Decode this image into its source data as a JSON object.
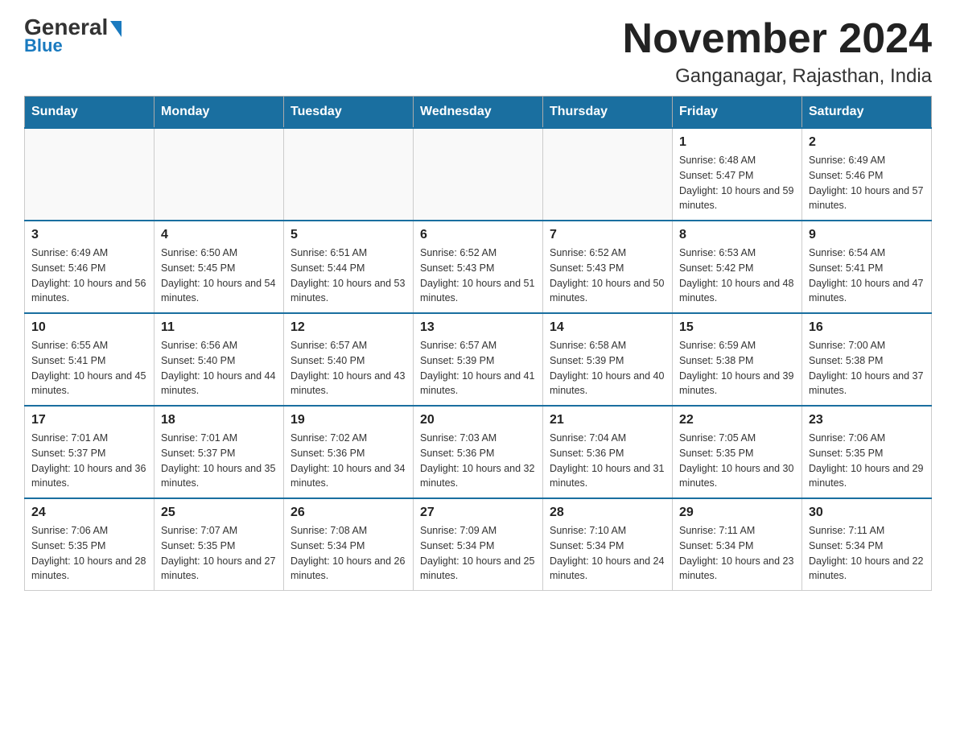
{
  "header": {
    "logo_general": "General",
    "logo_blue": "Blue",
    "title": "November 2024",
    "subtitle": "Ganganagar, Rajasthan, India"
  },
  "days_of_week": [
    "Sunday",
    "Monday",
    "Tuesday",
    "Wednesday",
    "Thursday",
    "Friday",
    "Saturday"
  ],
  "weeks": [
    {
      "days": [
        {
          "number": "",
          "info": ""
        },
        {
          "number": "",
          "info": ""
        },
        {
          "number": "",
          "info": ""
        },
        {
          "number": "",
          "info": ""
        },
        {
          "number": "",
          "info": ""
        },
        {
          "number": "1",
          "info": "Sunrise: 6:48 AM\nSunset: 5:47 PM\nDaylight: 10 hours and 59 minutes."
        },
        {
          "number": "2",
          "info": "Sunrise: 6:49 AM\nSunset: 5:46 PM\nDaylight: 10 hours and 57 minutes."
        }
      ]
    },
    {
      "days": [
        {
          "number": "3",
          "info": "Sunrise: 6:49 AM\nSunset: 5:46 PM\nDaylight: 10 hours and 56 minutes."
        },
        {
          "number": "4",
          "info": "Sunrise: 6:50 AM\nSunset: 5:45 PM\nDaylight: 10 hours and 54 minutes."
        },
        {
          "number": "5",
          "info": "Sunrise: 6:51 AM\nSunset: 5:44 PM\nDaylight: 10 hours and 53 minutes."
        },
        {
          "number": "6",
          "info": "Sunrise: 6:52 AM\nSunset: 5:43 PM\nDaylight: 10 hours and 51 minutes."
        },
        {
          "number": "7",
          "info": "Sunrise: 6:52 AM\nSunset: 5:43 PM\nDaylight: 10 hours and 50 minutes."
        },
        {
          "number": "8",
          "info": "Sunrise: 6:53 AM\nSunset: 5:42 PM\nDaylight: 10 hours and 48 minutes."
        },
        {
          "number": "9",
          "info": "Sunrise: 6:54 AM\nSunset: 5:41 PM\nDaylight: 10 hours and 47 minutes."
        }
      ]
    },
    {
      "days": [
        {
          "number": "10",
          "info": "Sunrise: 6:55 AM\nSunset: 5:41 PM\nDaylight: 10 hours and 45 minutes."
        },
        {
          "number": "11",
          "info": "Sunrise: 6:56 AM\nSunset: 5:40 PM\nDaylight: 10 hours and 44 minutes."
        },
        {
          "number": "12",
          "info": "Sunrise: 6:57 AM\nSunset: 5:40 PM\nDaylight: 10 hours and 43 minutes."
        },
        {
          "number": "13",
          "info": "Sunrise: 6:57 AM\nSunset: 5:39 PM\nDaylight: 10 hours and 41 minutes."
        },
        {
          "number": "14",
          "info": "Sunrise: 6:58 AM\nSunset: 5:39 PM\nDaylight: 10 hours and 40 minutes."
        },
        {
          "number": "15",
          "info": "Sunrise: 6:59 AM\nSunset: 5:38 PM\nDaylight: 10 hours and 39 minutes."
        },
        {
          "number": "16",
          "info": "Sunrise: 7:00 AM\nSunset: 5:38 PM\nDaylight: 10 hours and 37 minutes."
        }
      ]
    },
    {
      "days": [
        {
          "number": "17",
          "info": "Sunrise: 7:01 AM\nSunset: 5:37 PM\nDaylight: 10 hours and 36 minutes."
        },
        {
          "number": "18",
          "info": "Sunrise: 7:01 AM\nSunset: 5:37 PM\nDaylight: 10 hours and 35 minutes."
        },
        {
          "number": "19",
          "info": "Sunrise: 7:02 AM\nSunset: 5:36 PM\nDaylight: 10 hours and 34 minutes."
        },
        {
          "number": "20",
          "info": "Sunrise: 7:03 AM\nSunset: 5:36 PM\nDaylight: 10 hours and 32 minutes."
        },
        {
          "number": "21",
          "info": "Sunrise: 7:04 AM\nSunset: 5:36 PM\nDaylight: 10 hours and 31 minutes."
        },
        {
          "number": "22",
          "info": "Sunrise: 7:05 AM\nSunset: 5:35 PM\nDaylight: 10 hours and 30 minutes."
        },
        {
          "number": "23",
          "info": "Sunrise: 7:06 AM\nSunset: 5:35 PM\nDaylight: 10 hours and 29 minutes."
        }
      ]
    },
    {
      "days": [
        {
          "number": "24",
          "info": "Sunrise: 7:06 AM\nSunset: 5:35 PM\nDaylight: 10 hours and 28 minutes."
        },
        {
          "number": "25",
          "info": "Sunrise: 7:07 AM\nSunset: 5:35 PM\nDaylight: 10 hours and 27 minutes."
        },
        {
          "number": "26",
          "info": "Sunrise: 7:08 AM\nSunset: 5:34 PM\nDaylight: 10 hours and 26 minutes."
        },
        {
          "number": "27",
          "info": "Sunrise: 7:09 AM\nSunset: 5:34 PM\nDaylight: 10 hours and 25 minutes."
        },
        {
          "number": "28",
          "info": "Sunrise: 7:10 AM\nSunset: 5:34 PM\nDaylight: 10 hours and 24 minutes."
        },
        {
          "number": "29",
          "info": "Sunrise: 7:11 AM\nSunset: 5:34 PM\nDaylight: 10 hours and 23 minutes."
        },
        {
          "number": "30",
          "info": "Sunrise: 7:11 AM\nSunset: 5:34 PM\nDaylight: 10 hours and 22 minutes."
        }
      ]
    }
  ]
}
